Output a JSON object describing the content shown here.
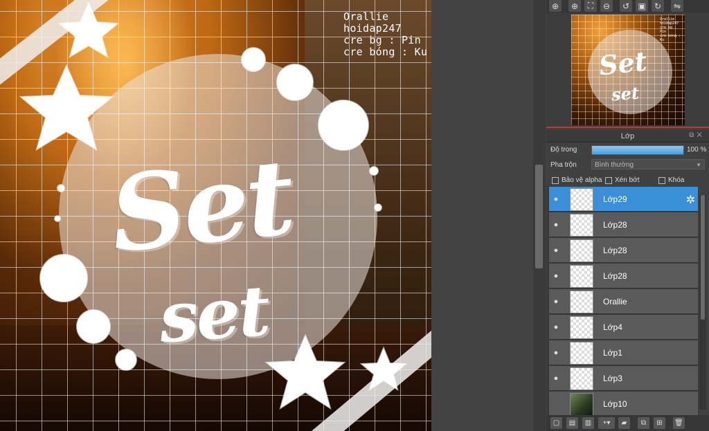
{
  "canvas": {
    "credits": [
      "Orallie",
      "hoidap247",
      "cre bg : Pin",
      "cre bóng : Ku"
    ],
    "title_main": "Set",
    "title_sub": "set"
  },
  "navigator": {
    "toolbar_icons": [
      "zoom-view-icon",
      "zoom-in-icon",
      "fit-icon",
      "zoom-out-icon",
      "rotate-left-icon",
      "fullscreen-icon",
      "rotate-right-icon",
      "flip-icon"
    ]
  },
  "layer_panel": {
    "title": "Lớp",
    "opacity_label": "Độ trong",
    "opacity_value": "100 %",
    "opacity_fraction": 1.0,
    "blend_label": "Pha trộn",
    "blend_value": "Bình thường",
    "checkbox_protect_alpha": "Bảo vệ alpha",
    "checkbox_clipping": "Xén bớt",
    "checkbox_lock": "Khóa",
    "layers": [
      {
        "name": "Lớp29",
        "selected": true,
        "visible": true
      },
      {
        "name": "Lớp28",
        "selected": false,
        "visible": true
      },
      {
        "name": "Lớp28",
        "selected": false,
        "visible": true
      },
      {
        "name": "Lớp28",
        "selected": false,
        "visible": true
      },
      {
        "name": "Orallie",
        "selected": false,
        "visible": true
      },
      {
        "name": "Lớp4",
        "selected": false,
        "visible": true
      },
      {
        "name": "Lớp1",
        "selected": false,
        "visible": true
      },
      {
        "name": "Lớp3",
        "selected": false,
        "visible": true
      },
      {
        "name": "Lớp10",
        "selected": false,
        "visible": false
      }
    ]
  },
  "colors": {
    "selected_layer": "#3a8fd8",
    "opacity_fill": "#4a9ee0",
    "panel_bg": "#404040"
  }
}
